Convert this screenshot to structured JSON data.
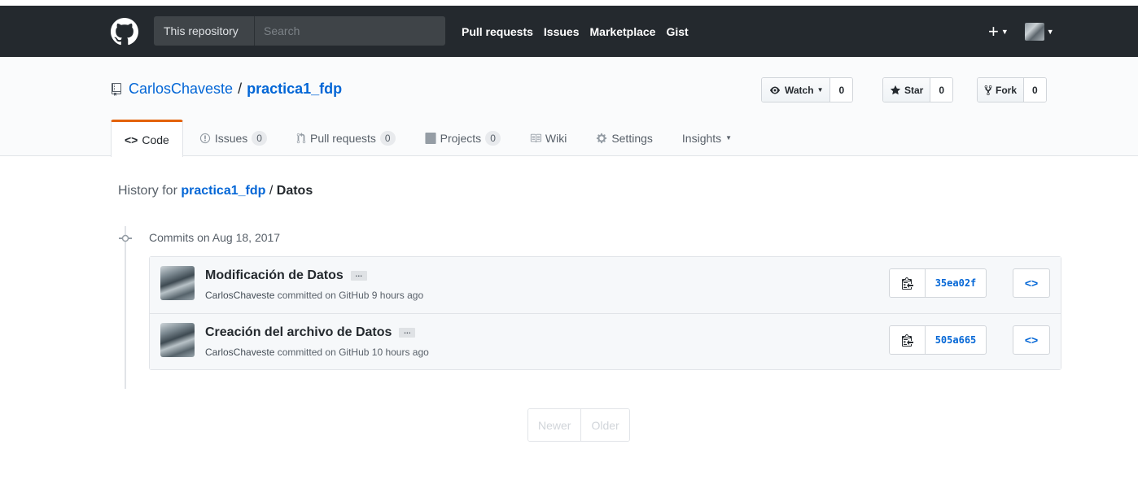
{
  "header": {
    "scope_label": "This repository",
    "search_placeholder": "Search",
    "nav": [
      "Pull requests",
      "Issues",
      "Marketplace",
      "Gist"
    ],
    "plus_label": "+"
  },
  "repo": {
    "owner": "CarlosChaveste",
    "separator": "/",
    "name": "practica1_fdp",
    "watch": {
      "label": "Watch",
      "count": "0"
    },
    "star": {
      "label": "Star",
      "count": "0"
    },
    "fork": {
      "label": "Fork",
      "count": "0"
    }
  },
  "tabs": [
    {
      "label": "Code",
      "selected": true
    },
    {
      "label": "Issues",
      "counter": "0"
    },
    {
      "label": "Pull requests",
      "counter": "0"
    },
    {
      "label": "Projects",
      "counter": "0"
    },
    {
      "label": "Wiki"
    },
    {
      "label": "Settings"
    },
    {
      "label": "Insights"
    }
  ],
  "breadcrumb": {
    "prefix": "History for",
    "repo": "practica1_fdp",
    "sep": "/",
    "path": "Datos"
  },
  "commit_group": {
    "title": "Commits on Aug 18, 2017",
    "commits": [
      {
        "message": "Modificación de Datos",
        "author": "CarlosChaveste",
        "meta": "committed on GitHub 9 hours ago",
        "sha": "35ea02f"
      },
      {
        "message": "Creación del archivo de Datos",
        "author": "CarlosChaveste",
        "meta": "committed on GitHub 10 hours ago",
        "sha": "505a665"
      }
    ]
  },
  "pagination": {
    "newer": "Newer",
    "older": "Older"
  },
  "colors": {
    "header_bg": "#24292e",
    "link": "#0366d6",
    "tab_accent": "#e36209"
  }
}
